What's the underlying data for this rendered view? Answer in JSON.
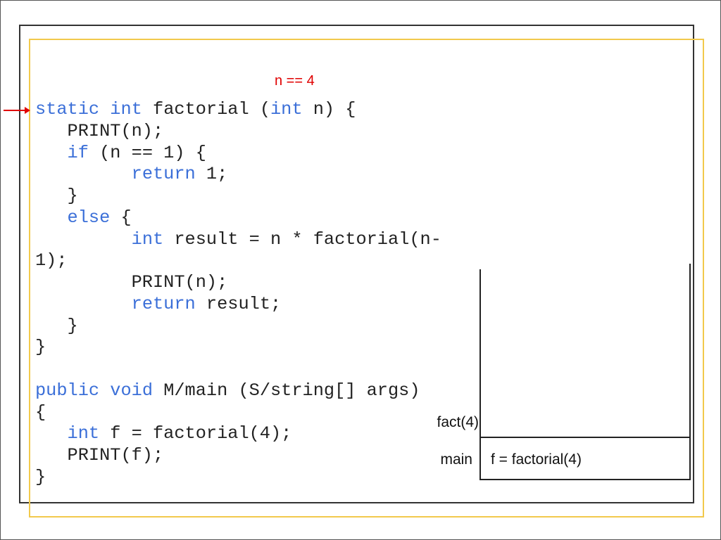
{
  "annotation": "n == 4",
  "colors": {
    "keyword": "#3b6fd8",
    "annotation": "#e00000",
    "frame_yellow": "#f2c94c",
    "arrow": "#e00000"
  },
  "code_lines": [
    [
      {
        "t": "static",
        "k": true
      },
      {
        "t": " "
      },
      {
        "t": "int",
        "k": true
      },
      {
        "t": " factorial ("
      },
      {
        "t": "int",
        "k": true
      },
      {
        "t": " n) {"
      }
    ],
    [
      {
        "t": "   PRINT(n);"
      }
    ],
    [
      {
        "t": "   "
      },
      {
        "t": "if",
        "k": true
      },
      {
        "t": " (n == 1) {"
      }
    ],
    [
      {
        "t": "         "
      },
      {
        "t": "return",
        "k": true
      },
      {
        "t": " 1;"
      }
    ],
    [
      {
        "t": "   }"
      }
    ],
    [
      {
        "t": "   "
      },
      {
        "t": "else",
        "k": true
      },
      {
        "t": " {"
      }
    ],
    [
      {
        "t": "         "
      },
      {
        "t": "int",
        "k": true
      },
      {
        "t": " result = n * factorial(n-"
      }
    ],
    [
      {
        "t": "1);"
      }
    ],
    [
      {
        "t": "         PRINT(n);"
      }
    ],
    [
      {
        "t": "         "
      },
      {
        "t": "return",
        "k": true
      },
      {
        "t": " result;"
      }
    ],
    [
      {
        "t": "   }"
      }
    ],
    [
      {
        "t": "}"
      }
    ],
    [
      {
        "t": ""
      }
    ],
    [
      {
        "t": "public",
        "k": true
      },
      {
        "t": " "
      },
      {
        "t": "void",
        "k": true
      },
      {
        "t": " M/main (S/string[] args)"
      }
    ],
    [
      {
        "t": "{"
      }
    ],
    [
      {
        "t": "   "
      },
      {
        "t": "int",
        "k": true
      },
      {
        "t": " f = factorial(4);"
      }
    ],
    [
      {
        "t": "   PRINT(f);"
      }
    ],
    [
      {
        "t": "}"
      }
    ]
  ],
  "stack": {
    "frames": [
      {
        "label": "fact(4)",
        "content": ""
      },
      {
        "label": "main",
        "content": "f = factorial(4)"
      }
    ]
  },
  "icons": {
    "pointer": "red-arrow-right"
  }
}
